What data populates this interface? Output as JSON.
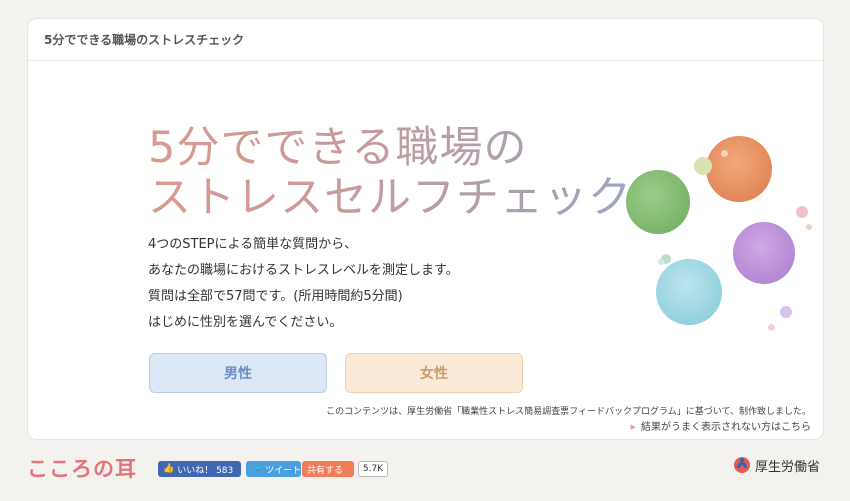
{
  "header": {
    "title": "5分でできる職場のストレスチェック"
  },
  "hero": {
    "title_line1": "5分でできる職場の",
    "title_line2": "ストレスセルフチェック",
    "desc": [
      "4つのSTEPによる簡単な質問から、",
      "あなたの職場におけるストレスレベルを測定します。",
      "質問は全部で57問です。(所用時間約5分間)",
      "はじめに性別を選んでください。"
    ]
  },
  "buttons": {
    "male": "男性",
    "female": "女性"
  },
  "notes": {
    "source": "このコンテンツは、厚生労働省「職業性ストレス簡易調査票フィードバックプログラム」に基づいて、制作致しました。",
    "link": "結果がうまく表示されない方はこちら"
  },
  "footer": {
    "logo": "こころの耳",
    "fb_label": "いいね！ 583",
    "tweet_label": "ツイート",
    "share_label": "共有する",
    "share_count": "5.7K",
    "ministry": "厚生労働省"
  },
  "colors": {
    "accent": "#e2757a",
    "male_button": "#dde8f7",
    "female_button": "#fbe9d8"
  }
}
